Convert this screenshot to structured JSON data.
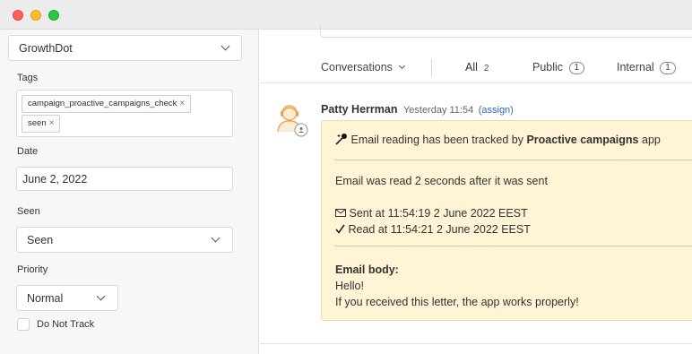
{
  "window": {
    "controls": [
      "close",
      "minimize",
      "maximize"
    ]
  },
  "sidebar": {
    "company_select": {
      "value": "GrowthDot"
    },
    "tags": {
      "label": "Tags",
      "items": [
        {
          "text": "campaign_proactive_campaigns_check",
          "remove": "×"
        },
        {
          "text": "seen",
          "remove": "×"
        }
      ]
    },
    "date": {
      "label": "Date",
      "value": "June 2, 2022"
    },
    "seen": {
      "label": "Seen",
      "value": "Seen"
    },
    "priority": {
      "label": "Priority",
      "value": "Normal"
    },
    "do_not_track": {
      "label": "Do Not Track",
      "checked": false
    }
  },
  "tabs": {
    "conversations": "Conversations",
    "all": {
      "label": "All",
      "count": "2"
    },
    "public": {
      "label": "Public",
      "count": "1"
    },
    "internal": {
      "label": "Internal",
      "count": "1"
    }
  },
  "message": {
    "author": "Patty Herrman",
    "time": "Yesterday 11:54",
    "assign": "(assign)",
    "header_prefix": "Email reading has been tracked by",
    "header_app": "Proactive campaigns",
    "header_suffix": "app",
    "read_info": "Email was read 2 seconds after it was sent",
    "sent_at": "Sent at 11:54:19 2 June 2022 EEST",
    "read_at": "Read at 11:54:21 2 June 2022 EEST",
    "body_label": "Email body:",
    "body_line1": "Hello!",
    "body_line2": "If you received this letter, the app works properly!"
  },
  "colors": {
    "card_bg": "#fff4d6",
    "link": "#2d6bb5",
    "close": "#fe5f57",
    "minimize": "#febc2e",
    "maximize": "#28c840"
  },
  "icons": {
    "avatar": "agent-avatar-icon",
    "sent": "envelope-icon",
    "read": "checkmark-icon",
    "header": "magic-wand-icon"
  }
}
